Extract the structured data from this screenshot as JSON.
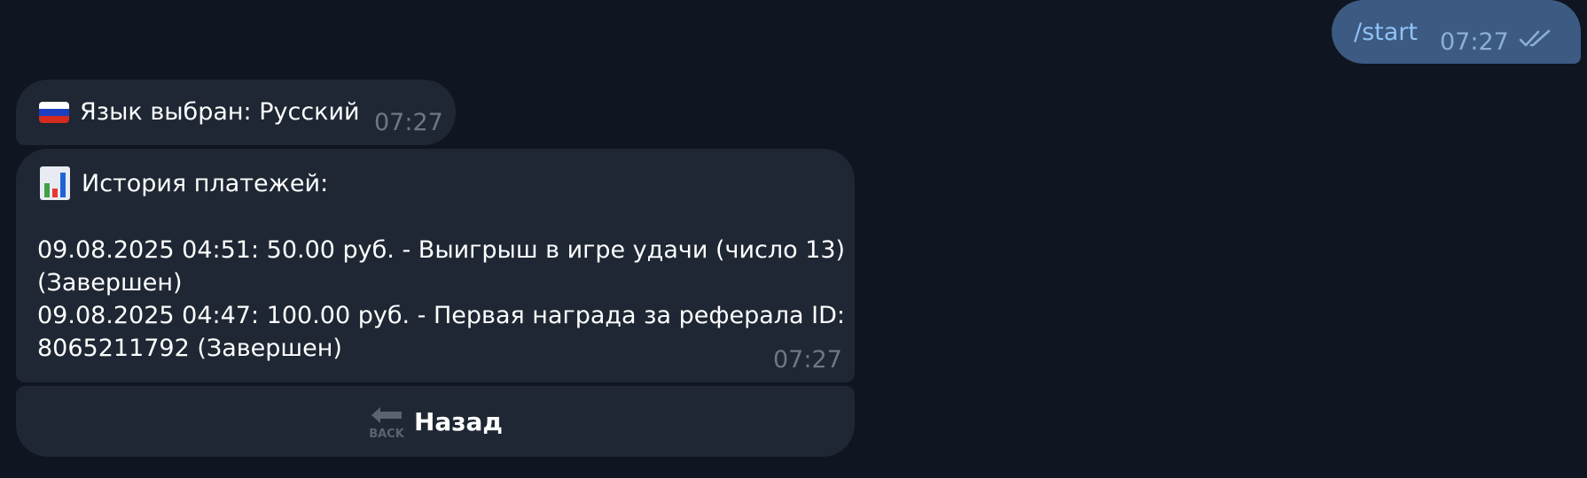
{
  "messages": {
    "outgoing": {
      "text": "/start",
      "time": "07:27"
    },
    "language": {
      "flag_icon": "russia-flag-icon",
      "text": "Язык выбран: Русский",
      "time": "07:27"
    },
    "history": {
      "icon": "bar-chart-icon",
      "title": "История платежей:",
      "lines": [
        "09.08.2025 04:51: 50.00 руб. - Выигрыш в игре удачи (число 13)",
        "(Завершен)",
        "09.08.2025 04:47: 100.00 руб. - Первая награда за реферала ID:",
        "8065211792 (Завершен)"
      ],
      "time": "07:27"
    }
  },
  "back_button": {
    "icon": "back-arrow-icon",
    "icon_text": "BACK",
    "label": "Назад"
  },
  "colors": {
    "background": "#0f1621",
    "incoming_bubble": "#1e2733",
    "outgoing_bubble": "#3c5a82",
    "outgoing_text": "#8fc2f5"
  }
}
